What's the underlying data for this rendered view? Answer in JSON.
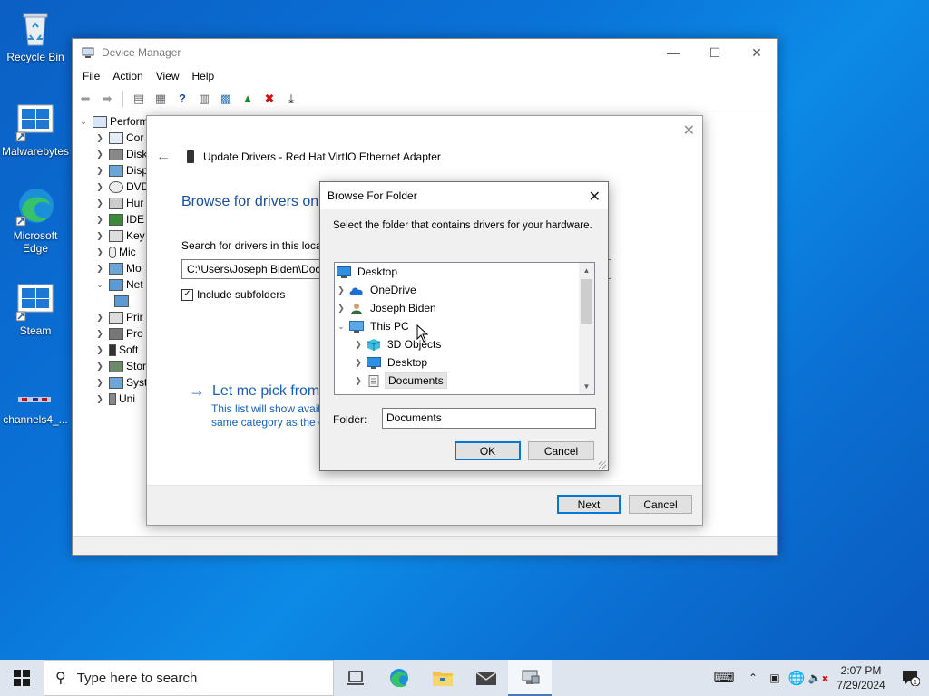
{
  "desktop": {
    "icons": [
      {
        "label": "Recycle Bin"
      },
      {
        "label": "Malwarebytes"
      },
      {
        "label": "Microsoft Edge"
      },
      {
        "label": "Steam"
      },
      {
        "label": "channels4_..."
      }
    ]
  },
  "device_manager": {
    "title": "Device Manager",
    "menu": [
      "File",
      "Action",
      "View",
      "Help"
    ],
    "tree": [
      {
        "label": "Perform",
        "expanded": true
      },
      {
        "label": "Cor"
      },
      {
        "label": "Disk"
      },
      {
        "label": "Disp"
      },
      {
        "label": "DVD"
      },
      {
        "label": "Hur"
      },
      {
        "label": "IDE"
      },
      {
        "label": "Key"
      },
      {
        "label": "Mic"
      },
      {
        "label": "Mo"
      },
      {
        "label": "Net",
        "expanded": true
      },
      {
        "label": ""
      },
      {
        "label": "Prir"
      },
      {
        "label": "Pro"
      },
      {
        "label": "Soft"
      },
      {
        "label": "Stor"
      },
      {
        "label": "Syst"
      },
      {
        "label": "Uni"
      }
    ]
  },
  "update_drivers": {
    "header": "Update Drivers - Red Hat VirtIO Ethernet Adapter",
    "heading": "Browse for drivers on",
    "search_label": "Search for drivers in this loca",
    "path_value": "C:\\Users\\Joseph Biden\\Doc",
    "include_subfolders": "Include subfolders",
    "pick_link": "Let me pick from",
    "pick_desc": "This list will show avail same category as the d",
    "next": "Next",
    "cancel": "Cancel"
  },
  "browse_folder": {
    "title": "Browse For Folder",
    "description": "Select the folder that contains drivers for your hardware.",
    "tree": [
      {
        "label": "Desktop",
        "level": 0
      },
      {
        "label": "OneDrive",
        "level": 1
      },
      {
        "label": "Joseph Biden",
        "level": 1
      },
      {
        "label": "This PC",
        "level": 1
      },
      {
        "label": "3D Objects",
        "level": 2
      },
      {
        "label": "Desktop",
        "level": 2
      },
      {
        "label": "Documents",
        "level": 2,
        "selected": true
      }
    ],
    "folder_label": "Folder:",
    "folder_value": "Documents",
    "ok": "OK",
    "cancel": "Cancel"
  },
  "taskbar": {
    "search_placeholder": "Type here to search",
    "time": "2:07 PM",
    "date": "7/29/2024",
    "notification_count": "1"
  }
}
